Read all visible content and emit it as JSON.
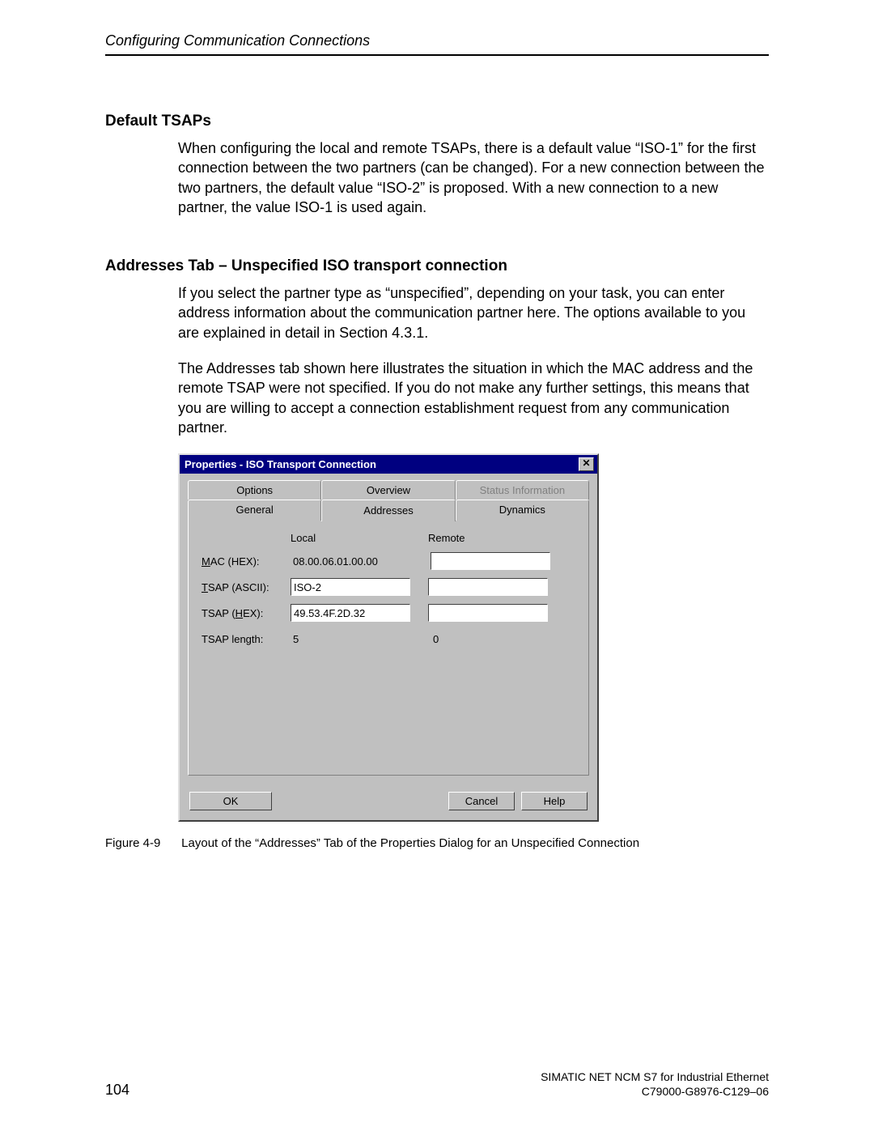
{
  "header": {
    "running_title": "Configuring Communication Connections"
  },
  "sections": {
    "s1": {
      "heading": "Default TSAPs",
      "para1": "When configuring the local and remote TSAPs, there is a default value “ISO-1” for the first connection between the two partners (can be changed). For a new connection between the two partners, the default value “ISO-2” is proposed. With a new connection to a new partner, the value ISO-1 is used again."
    },
    "s2": {
      "heading": "Addresses Tab – Unspecified ISO transport connection",
      "para1": "If you select the partner type as “unspecified”, depending on your task, you can enter address information about the communication partner here. The options available to you are explained in detail in Section 4.3.1.",
      "para2": "The Addresses tab shown here illustrates the situation in which the MAC address and the remote TSAP were not specified. If you do not make any further settings, this means that you are willing to accept a connection establishment request from any communication partner."
    }
  },
  "dialog": {
    "title": "Properties - ISO Transport Connection",
    "close_glyph": "✕",
    "tabs": {
      "back_row": [
        "Options",
        "Overview",
        "Status Information"
      ],
      "front_row": [
        "General",
        "Addresses",
        "Dynamics"
      ],
      "active": "Addresses"
    },
    "columns": {
      "local": "Local",
      "remote": "Remote"
    },
    "rows": {
      "mac": {
        "label_pre": "",
        "label_u": "M",
        "label_post": "AC  (HEX):",
        "local": "08.00.06.01.00.00",
        "remote": ""
      },
      "tsap_asc": {
        "label_pre": "",
        "label_u": "T",
        "label_post": "SAP (ASCII):",
        "local": "ISO-2",
        "remote": ""
      },
      "tsap_hex": {
        "label_pre": "TSAP (",
        "label_u": "H",
        "label_post": "EX):",
        "local": "49.53.4F.2D.32",
        "remote": ""
      },
      "tsap_len": {
        "label": "TSAP length:",
        "local": "5",
        "remote": "0"
      }
    },
    "buttons": {
      "ok": "OK",
      "cancel": "Cancel",
      "help": "Help"
    }
  },
  "figure": {
    "label": "Figure 4-9",
    "caption": "Layout of the “Addresses” Tab of the Properties Dialog for an Unspecified Connection"
  },
  "footer": {
    "page_number": "104",
    "doc_line1": "SIMATIC NET NCM S7 for Industrial Ethernet",
    "doc_line2": "C79000-G8976-C129–06"
  }
}
